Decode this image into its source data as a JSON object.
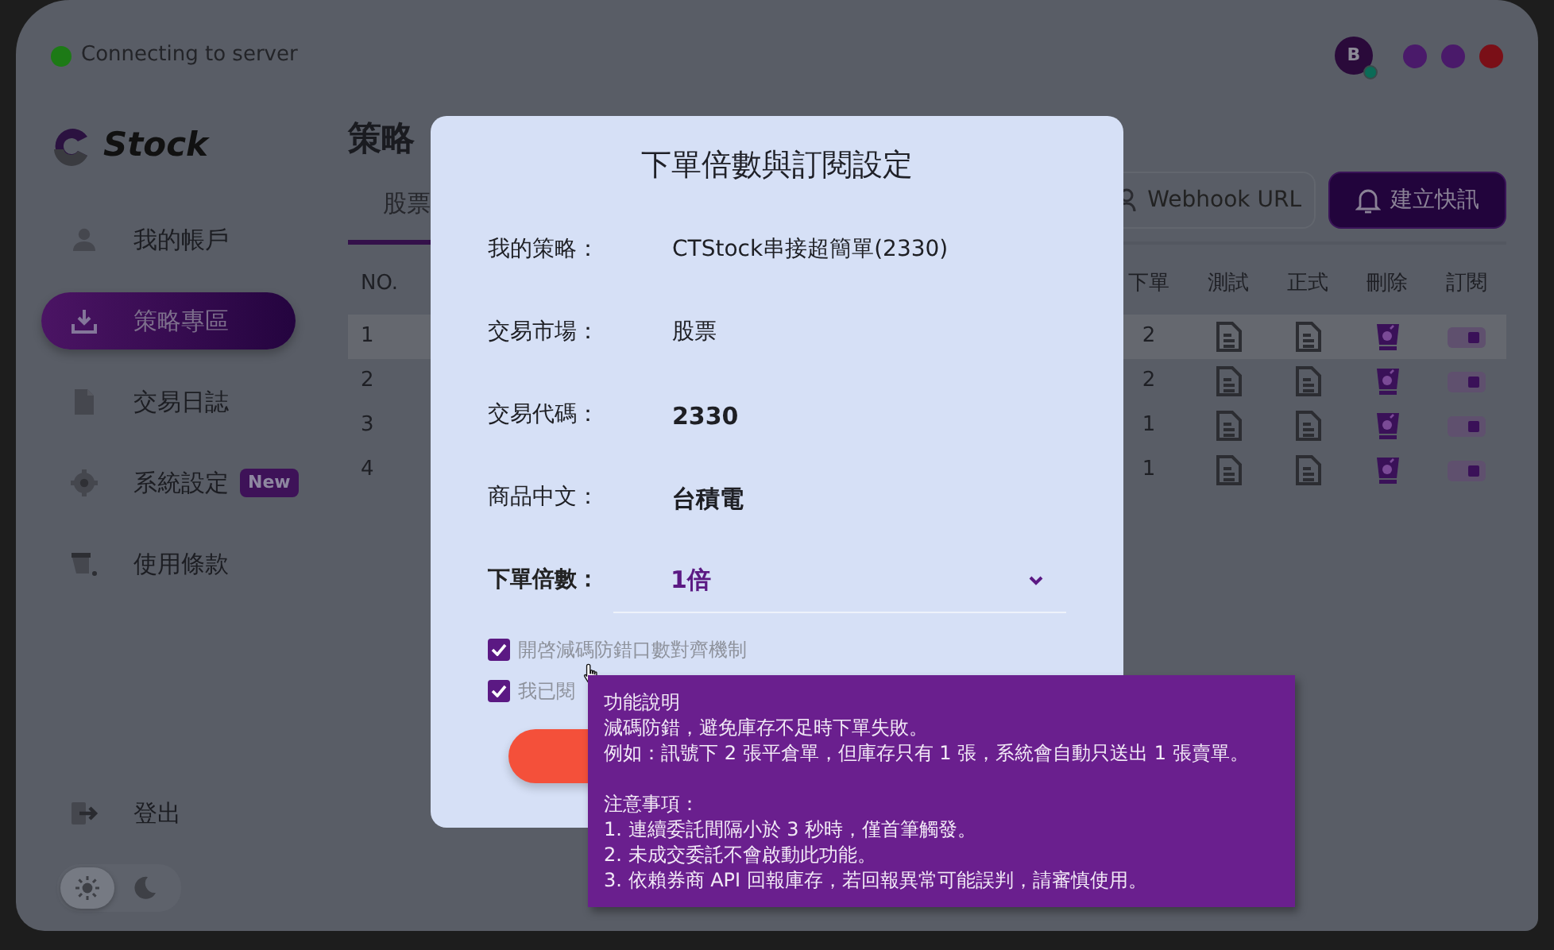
{
  "status": {
    "text": "Connecting to server",
    "connected": true
  },
  "account": {
    "avatar_letter": "B",
    "online": true
  },
  "window_controls": [
    {
      "kind": "minimize"
    },
    {
      "kind": "maximize"
    },
    {
      "kind": "close"
    }
  ],
  "sidebar": {
    "logo": "Stock",
    "items": [
      {
        "label": "我的帳戶",
        "selected": false
      },
      {
        "label": "策略專區",
        "selected": true
      },
      {
        "label": "交易日誌",
        "selected": false
      },
      {
        "label": "系統設定",
        "selected": false,
        "badge": "New"
      },
      {
        "label": "使用條款",
        "selected": false
      }
    ],
    "logout": "登出",
    "dark_mode": false
  },
  "page": {
    "title": "策略",
    "tabs": [
      {
        "label": "股票",
        "selected": true
      }
    ],
    "webhook_button": "Webhook URL",
    "alert_button": "建立快訊"
  },
  "table": {
    "columns": [
      "NO.",
      "下單",
      "測試",
      "正式",
      "刪除",
      "訂閱"
    ],
    "rows": [
      {
        "no": "1",
        "quantity": "2",
        "subscribed": true,
        "selected": true
      },
      {
        "no": "2",
        "quantity": "2",
        "subscribed": true,
        "selected": false
      },
      {
        "no": "3",
        "quantity": "1",
        "subscribed": true,
        "selected": false
      },
      {
        "no": "4",
        "quantity": "1",
        "subscribed": true,
        "selected": false
      }
    ]
  },
  "modal": {
    "title": "下單倍數與訂閱設定",
    "fields": [
      {
        "label": "我的策略：",
        "value": "CTStock串接超簡單(2330)",
        "bold": false
      },
      {
        "label": "交易市場：",
        "value": "股票",
        "bold": false
      },
      {
        "label": "交易代碼：",
        "value": "2330",
        "bold": true
      },
      {
        "label": "商品中文：",
        "value": "台積電",
        "bold": true
      }
    ],
    "multiplier": {
      "label": "下單倍數：",
      "value": "1倍"
    },
    "checkboxes": [
      {
        "label": "開啓減碼防錯口數對齊機制",
        "checked": true
      },
      {
        "label": "我已閱",
        "checked": true
      }
    ]
  },
  "tooltip": {
    "sections": [
      {
        "heading": "功能說明",
        "lines": [
          "減碼防錯，避免庫存不足時下單失敗。",
          "例如：訊號下 2 張平倉單，但庫存只有 1 張，系統會自動只送出 1 張賣單。"
        ]
      },
      {
        "heading": "注意事項：",
        "lines": [
          "1. 連續委託間隔小於 3 秒時，僅首筆觸發。",
          "2. 未成交委託不會啟動此功能。",
          "3. 依賴券商 API 回報庫存，若回報異常可能誤判，請審慎使用。"
        ]
      }
    ]
  }
}
